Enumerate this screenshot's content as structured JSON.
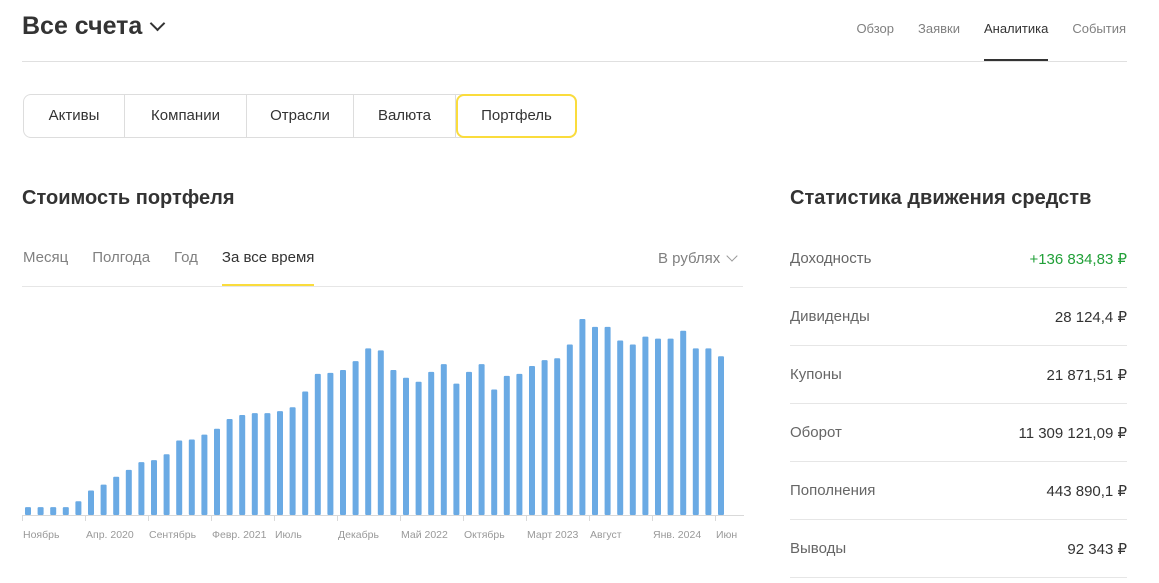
{
  "header": {
    "account_title": "Все счета",
    "nav": [
      {
        "label": "Обзор",
        "active": false
      },
      {
        "label": "Заявки",
        "active": false
      },
      {
        "label": "Аналитика",
        "active": true
      },
      {
        "label": "События",
        "active": false
      }
    ]
  },
  "segments": [
    {
      "label": "Активы",
      "active": false
    },
    {
      "label": "Компании",
      "active": false
    },
    {
      "label": "Отрасли",
      "active": false
    },
    {
      "label": "Валюта",
      "active": false
    },
    {
      "label": "Портфель",
      "active": true
    }
  ],
  "portfolio": {
    "title": "Стоимость портфеля",
    "periods": [
      {
        "label": "Месяц",
        "active": false
      },
      {
        "label": "Полгода",
        "active": false
      },
      {
        "label": "Год",
        "active": false
      },
      {
        "label": "За все время",
        "active": true
      }
    ],
    "currency_label": "В рублях"
  },
  "chart_data": {
    "type": "bar",
    "title": "",
    "xlabel": "",
    "ylabel": "",
    "grid": false,
    "bar_color": "#6aaae4",
    "x_tick_labels": [
      "Ноябрь",
      "Апр. 2020",
      "Сентябрь",
      "Февр. 2021",
      "Июль",
      "Декабрь",
      "Май 2022",
      "Октябрь",
      "Март 2023",
      "Август",
      "Янв. 2024",
      "Июн"
    ],
    "values_relative": [
      0.04,
      0.04,
      0.04,
      0.04,
      0.07,
      0.125,
      0.155,
      0.195,
      0.23,
      0.27,
      0.28,
      0.31,
      0.38,
      0.385,
      0.41,
      0.44,
      0.49,
      0.51,
      0.52,
      0.52,
      0.53,
      0.55,
      0.63,
      0.72,
      0.725,
      0.74,
      0.785,
      0.85,
      0.84,
      0.74,
      0.7,
      0.68,
      0.73,
      0.77,
      0.67,
      0.73,
      0.77,
      0.64,
      0.71,
      0.72,
      0.76,
      0.79,
      0.8,
      0.87,
      1.0,
      0.96,
      0.96,
      0.89,
      0.87,
      0.91,
      0.9,
      0.9,
      0.94,
      0.85,
      0.85,
      0.81
    ]
  },
  "stats": {
    "title": "Статистика движения средств",
    "rows": [
      {
        "label": "Доходность",
        "value": "+136 834,83 ₽",
        "positive": true
      },
      {
        "label": "Дивиденды",
        "value": "28 124,4 ₽",
        "positive": false
      },
      {
        "label": "Купоны",
        "value": "21 871,51 ₽",
        "positive": false
      },
      {
        "label": "Оборот",
        "value": "11 309 121,09 ₽",
        "positive": false
      },
      {
        "label": "Пополнения",
        "value": "443 890,1 ₽",
        "positive": false
      },
      {
        "label": "Выводы",
        "value": "92 343 ₽",
        "positive": false
      }
    ]
  },
  "colors": {
    "accent": "#fadc3c",
    "bar": "#6aaae4",
    "positive": "#21a038"
  }
}
